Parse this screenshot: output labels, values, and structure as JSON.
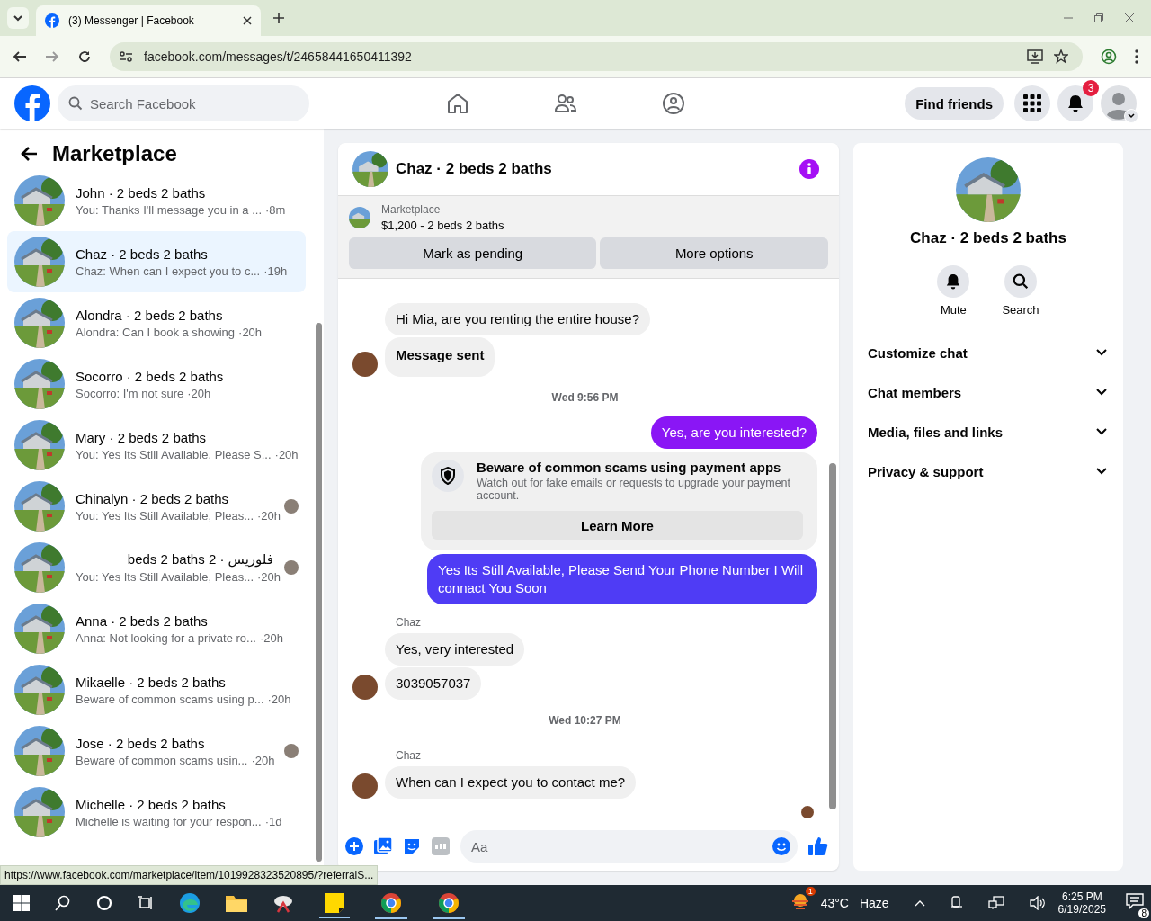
{
  "browser": {
    "tab_title": "(3) Messenger | Facebook",
    "url": "facebook.com/messages/t/24658441650411392",
    "status_url": "https://www.facebook.com/marketplace/item/1019928323520895/?referralS..."
  },
  "header": {
    "search_placeholder": "Search Facebook",
    "find_friends": "Find friends",
    "notification_count": "3"
  },
  "sidebar": {
    "title": "Marketplace",
    "conversations": [
      {
        "name": "John · 2 beds 2 baths",
        "preview": "You: Thanks I'll message you in a ...",
        "time": "·8m",
        "selected": false,
        "seen": false
      },
      {
        "name": "Chaz · 2 beds 2 baths",
        "preview": "Chaz: When can I expect you to c...",
        "time": "·19h",
        "selected": true,
        "seen": false
      },
      {
        "name": "Alondra · 2 beds 2 baths",
        "preview": "Alondra: Can I book a showing",
        "time": "·20h",
        "selected": false,
        "seen": false
      },
      {
        "name": "Socorro · 2 beds 2 baths",
        "preview": "Socorro: I'm not sure",
        "time": "·20h",
        "selected": false,
        "seen": false
      },
      {
        "name": "Mary · 2 beds 2 baths",
        "preview": "You: Yes Its Still Available, Please S...",
        "time": "·20h",
        "selected": false,
        "seen": false
      },
      {
        "name": "Chinalyn · 2 beds 2 baths",
        "preview": "You: Yes Its Still Available, Pleas...",
        "time": "·20h",
        "selected": false,
        "seen": true
      },
      {
        "name": "فلوريس · 2 beds 2 baths",
        "preview": "You: Yes Its Still Available, Pleas...",
        "time": "·20h",
        "selected": false,
        "seen": true
      },
      {
        "name": "Anna · 2 beds 2 baths",
        "preview": "Anna: Not looking for a private ro...",
        "time": "·20h",
        "selected": false,
        "seen": false
      },
      {
        "name": "Mikaelle · 2 beds 2 baths",
        "preview": "Beware of common scams using p...",
        "time": "·20h",
        "selected": false,
        "seen": false
      },
      {
        "name": "Jose · 2 beds 2 baths",
        "preview": "Beware of common scams usin...",
        "time": "·20h",
        "selected": false,
        "seen": true
      },
      {
        "name": "Michelle · 2 beds 2 baths",
        "preview": "Michelle is waiting for your respon...",
        "time": "·1d",
        "selected": false,
        "seen": false
      }
    ]
  },
  "chat": {
    "title": "Chaz · 2 beds 2 baths",
    "listing": {
      "label": "Marketplace",
      "price_title": "$1,200 - 2 beds 2 baths",
      "buttons": [
        "Mark as pending",
        "More options"
      ]
    },
    "messages": [
      {
        "kind": "incoming",
        "text": "Hi Mia, are you renting the entire house?",
        "avatar": false,
        "bold": false
      },
      {
        "kind": "incoming",
        "text": "Message sent",
        "avatar": true,
        "bold": true
      },
      {
        "kind": "timestamp",
        "text": "Wed 9:56 PM"
      },
      {
        "kind": "outgoing",
        "text": "Yes, are you interested?",
        "color": "#8a16f5"
      },
      {
        "kind": "warning",
        "title": "Beware of common scams using payment apps",
        "body": "Watch out for fake emails or requests to upgrade your payment account.",
        "button": "Learn More"
      },
      {
        "kind": "outgoing",
        "text": "Yes Its Still Available, Please Send Your Phone Number I Will connact You Soon",
        "color": "#4f3cf5"
      },
      {
        "kind": "sender",
        "text": "Chaz"
      },
      {
        "kind": "incoming",
        "text": "Yes, very interested",
        "avatar": false,
        "bold": false
      },
      {
        "kind": "incoming",
        "text": "3039057037",
        "avatar": true,
        "bold": false
      },
      {
        "kind": "timestamp",
        "text": "Wed 10:27 PM"
      },
      {
        "kind": "sender",
        "text": "Chaz"
      },
      {
        "kind": "incoming",
        "text": "When can I expect you to contact me?",
        "avatar": true,
        "bold": false
      }
    ],
    "composer_placeholder": "Aa"
  },
  "details": {
    "name": "Chaz · 2 beds 2 baths",
    "actions": [
      {
        "kind": "mute",
        "label": "Mute"
      },
      {
        "kind": "search",
        "label": "Search"
      }
    ],
    "sections": [
      {
        "label": "Customize chat",
        "expanded": false
      },
      {
        "label": "Chat members",
        "expanded": false
      },
      {
        "label": "Media, files and links",
        "expanded": false
      },
      {
        "label": "Privacy & support",
        "expanded": false
      }
    ]
  },
  "taskbar": {
    "weather_badge": "1",
    "temperature": "43°C",
    "condition": "Haze",
    "time": "6:25 PM",
    "date": "6/19/2025",
    "notification_count": "8"
  }
}
